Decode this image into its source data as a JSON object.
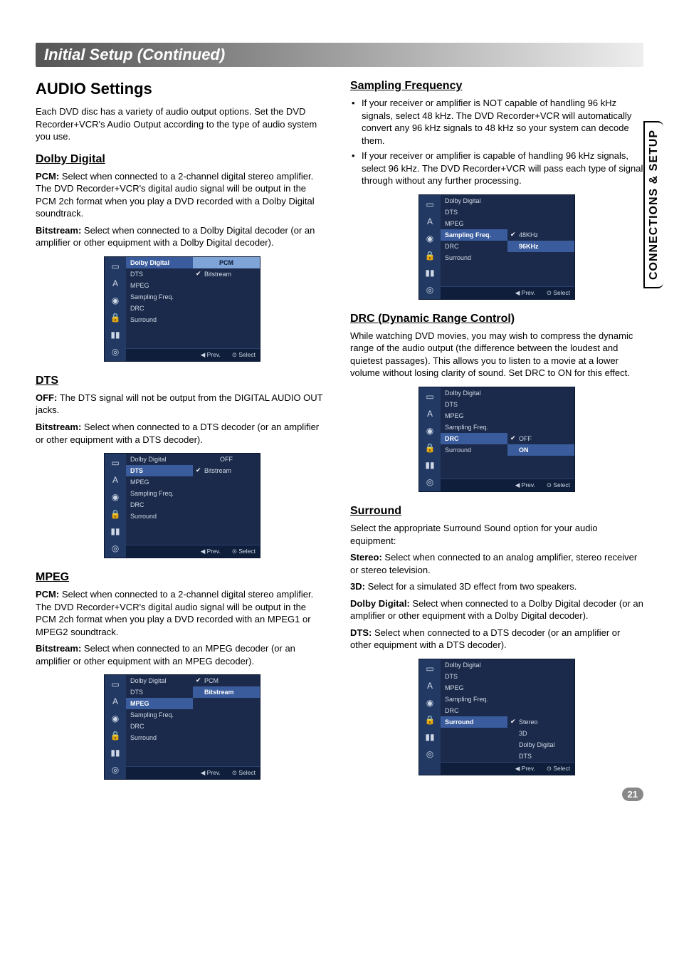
{
  "sideTab": "CONNECTIONS & SETUP",
  "pageNumber": "21",
  "sectionHeader": "Initial Setup (Continued)",
  "mainHeading": "AUDIO Settings",
  "intro": "Each DVD disc has a variety of audio output options. Set the DVD Recorder+VCR's Audio Output according to the type of audio system you use.",
  "dolby": {
    "heading": "Dolby Digital",
    "pcmLabel": "PCM:",
    "pcmText": " Select when connected to a 2-channel digital stereo amplifier. The DVD Recorder+VCR's digital audio signal will be output in the PCM 2ch format when you play a DVD recorded with a Dolby Digital soundtrack.",
    "bitLabel": "Bitstream:",
    "bitText": " Select when connected to a Dolby Digital decoder (or an amplifier or other equipment with a Dolby Digital decoder)."
  },
  "dts": {
    "heading": "DTS",
    "offLabel": "OFF:",
    "offText": " The DTS signal will not be output from the DIGITAL AUDIO OUT jacks.",
    "bitLabel": "Bitstream:",
    "bitText": " Select when connected to a DTS decoder (or an amplifier or other equipment with a DTS decoder)."
  },
  "mpeg": {
    "heading": "MPEG",
    "pcmLabel": "PCM:",
    "pcmText": " Select when connected to a 2-channel digital stereo amplifier. The DVD Recorder+VCR's digital audio signal will be output in the PCM 2ch format when you play a DVD recorded with an MPEG1 or MPEG2 soundtrack.",
    "bitLabel": "Bitstream:",
    "bitText": " Select when connected to an MPEG decoder (or an amplifier or other equipment with an MPEG decoder)."
  },
  "sampling": {
    "heading": "Sampling Frequency",
    "b1": "If your receiver or amplifier is NOT capable of handling 96 kHz signals, select 48 kHz. The DVD Recorder+VCR will automatically convert any 96 kHz signals to 48 kHz so your system can decode them.",
    "b2": "If your receiver or amplifier is capable of handling 96 kHz signals, select 96 kHz. The DVD Recorder+VCR will pass each type of signal through without any further processing."
  },
  "drc": {
    "heading": "DRC (Dynamic Range Control)",
    "text": "While watching DVD movies, you may wish to compress the dynamic range of the audio output (the difference between the loudest and quietest passages). This allows you to listen to a movie at a lower volume without losing clarity of sound. Set DRC to ON for this effect."
  },
  "surround": {
    "heading": "Surround",
    "intro": "Select the appropriate Surround Sound option for your audio equipment:",
    "stereoLabel": "Stereo:",
    "stereoText": " Select when connected to an analog amplifier, stereo receiver or stereo television.",
    "threeDLabel": "3D:",
    "threeDText": " Select for a simulated 3D effect from two speakers.",
    "ddLabel": "Dolby Digital:",
    "ddText": " Select when connected to a Dolby Digital decoder (or an amplifier or other equipment with a Dolby Digital decoder).",
    "dtsLabel": "DTS:",
    "dtsText": " Select when connected to a DTS decoder (or an amplifier or other equipment with a DTS decoder)."
  },
  "menuItems": {
    "list": [
      "Dolby Digital",
      "DTS",
      "MPEG",
      "Sampling Freq.",
      "DRC",
      "Surround"
    ],
    "footerPrev": "◀ Prev.",
    "footerSelect": "⊙ Select",
    "pcmHeader": "PCM",
    "bitstream": "Bitstream",
    "off": "OFF",
    "pcm": "PCM",
    "k48": "48KHz",
    "k96": "96KHz",
    "drcOff": "OFF",
    "drcOn": "ON",
    "stereo": "Stereo",
    "s3d": "3D",
    "sDD": "Dolby Digital",
    "sDTS": "DTS"
  }
}
